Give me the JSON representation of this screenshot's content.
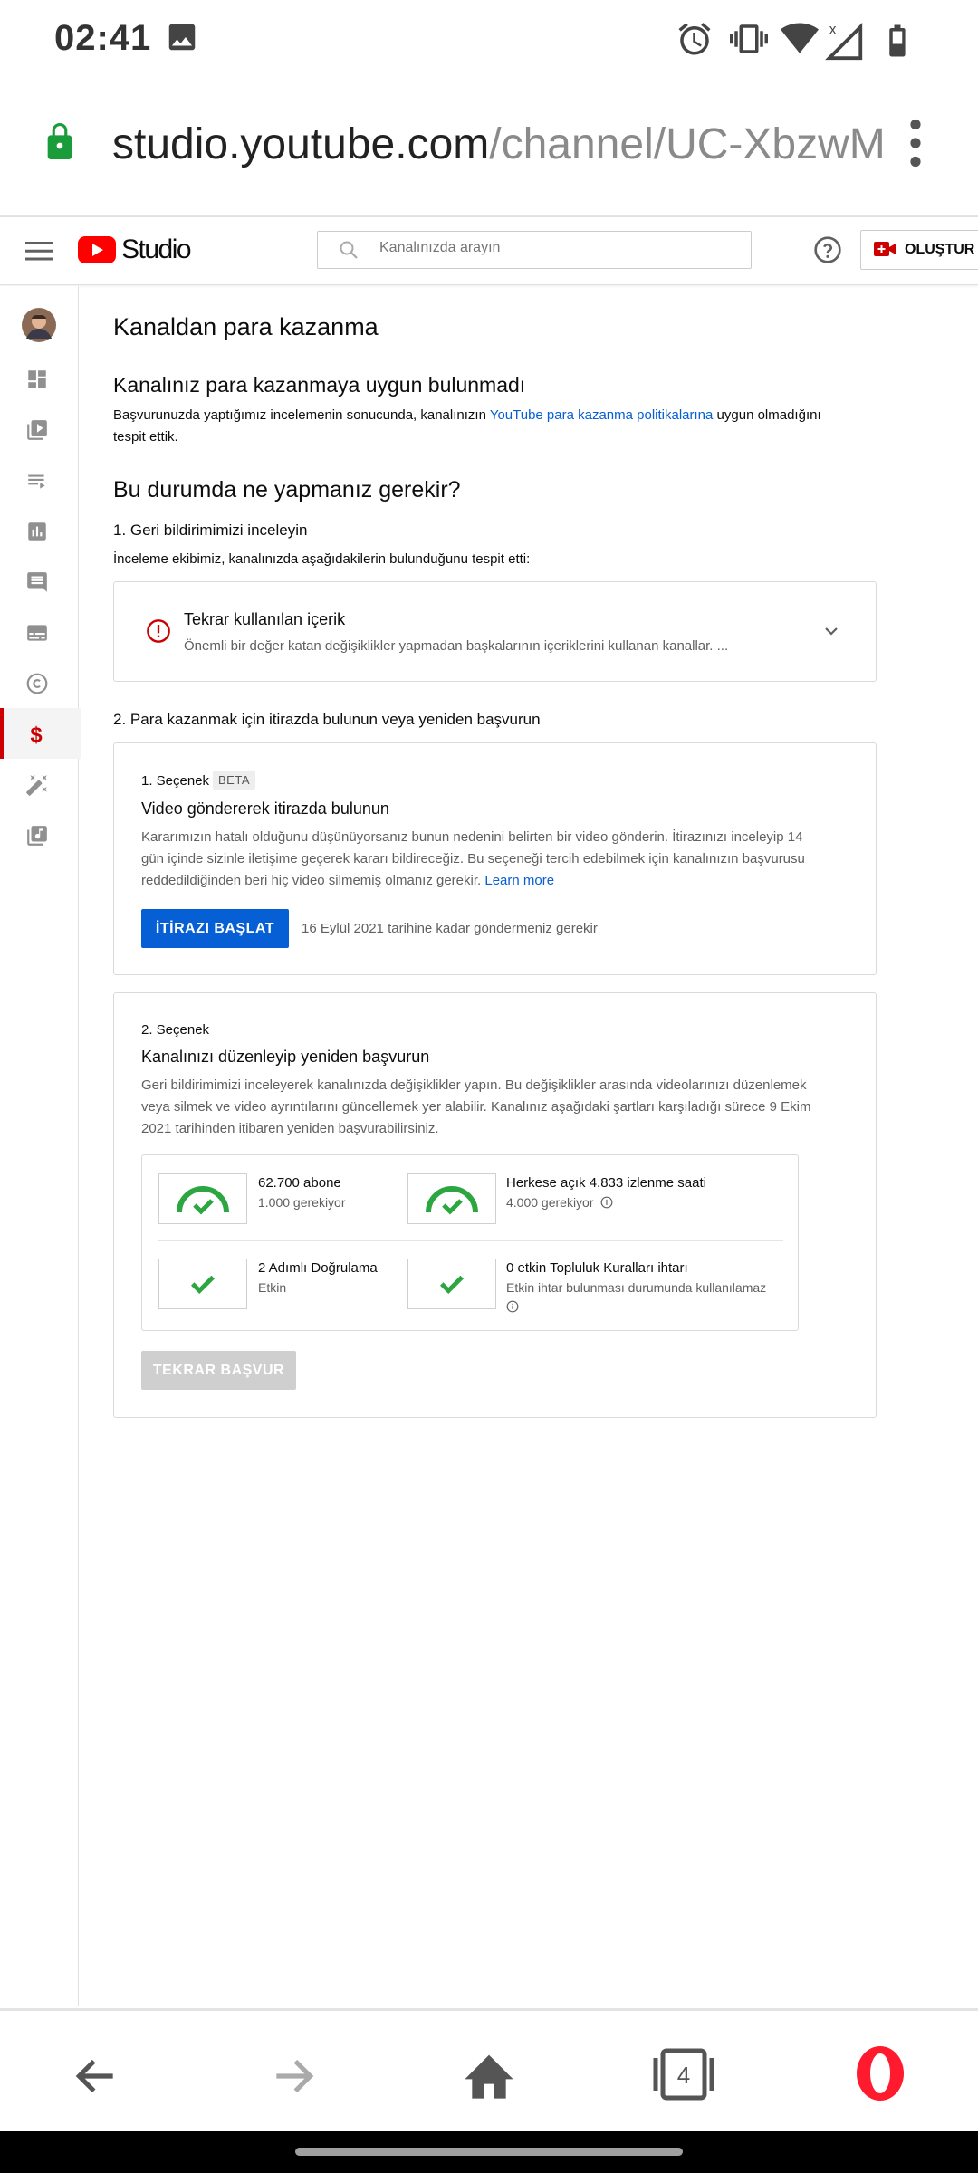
{
  "status_bar": {
    "time": "02:41",
    "icons": [
      "image-icon",
      "alarm-icon",
      "vibrate-icon",
      "wifi-icon",
      "signal-icon",
      "battery-icon"
    ]
  },
  "browser": {
    "url_host": "studio.youtube.com",
    "url_path": "/channel/UC-XbzwM",
    "tab_count": "4"
  },
  "studio_header": {
    "logo_text": "Studio",
    "search_placeholder": "Kanalınızda arayın",
    "create_label": "OLUŞTUR"
  },
  "sidebar": {
    "items": [
      "avatar",
      "dashboard-icon",
      "content-icon",
      "playlists-icon",
      "analytics-icon",
      "comments-icon",
      "subtitles-icon",
      "copyright-icon",
      "monetization-icon",
      "customization-icon",
      "audio-library-icon"
    ],
    "active": "monetization-icon"
  },
  "page": {
    "title": "Kanaldan para kazanma",
    "status_heading": "Kanalınız para kazanmaya uygun bulunmadı",
    "status_text_1": "Başvurunuzda yaptığımız incelemenin sonucunda, kanalınızın ",
    "status_link": "YouTube para kazanma politikalarına",
    "status_text_2": " uygun olmadığını",
    "status_text_3": "tespit ettik.",
    "what_heading": "Bu durumda ne yapmanız gerekir?",
    "step1_heading": "1. Geri bildirimimizi inceleyin",
    "step1_text": "İnceleme ekibimiz, kanalınızda aşağıdakilerin bulunduğunu tespit etti:",
    "issue": {
      "title": "Tekrar kullanılan içerik",
      "desc": "Önemli bir değer katan değişiklikler yapmadan başkalarının içeriklerini kullanan kanallar. ..."
    },
    "step2_heading": "2. Para kazanmak için itirazda bulunun veya yeniden başvurun",
    "option1": {
      "label": "1. Seçenek",
      "badge": "BETA",
      "title": "Video göndererek itirazda bulunun",
      "desc_1": "Kararımızın hatalı olduğunu düşünüyorsanız bunun nedenini belirten bir video gönderin. İtirazınızı inceleyip 14",
      "desc_2": "gün içinde sizinle iletişime geçerek kararı bildireceğiz. Bu seçeneği tercih edebilmek için kanalınızın başvurusu",
      "desc_3": "reddedildiğinden beri hiç video silmemiş olmanız gerekir. ",
      "learn_more": "Learn more",
      "button": "İTİRAZI BAŞLAT",
      "deadline": "16 Eylül 2021 tarihine kadar göndermeniz gerekir"
    },
    "option2": {
      "label": "2. Seçenek",
      "title": "Kanalınızı düzenleyip yeniden başvurun",
      "desc_1": "Geri bildirimimizi inceleyerek kanalınızda değişiklikler yapın. Bu değişiklikler arasında videolarınızı düzenlemek",
      "desc_2": "veya silmek ve video ayrıntılarını güncellemek yer alabilir. Kanalınız aşağıdaki şartları karşıladığı sürece 9 Ekim",
      "desc_3": "2021 tarihinden itibaren yeniden başvurabilirsiniz.",
      "requirements": [
        {
          "title": "62.700 abone",
          "sub": "1.000 gerekiyor"
        },
        {
          "title": "Herkese açık 4.833 izlenme saati",
          "sub": "4.000 gerekiyor"
        },
        {
          "title": "2 Adımlı Doğrulama",
          "sub": "Etkin"
        },
        {
          "title": "0 etkin Topluluk Kuralları ihtarı",
          "sub": "Etkin ihtar bulunması durumunda kullanılamaz"
        }
      ],
      "button": "TEKRAR BAŞVUR"
    }
  },
  "colors": {
    "accent_blue": "#065fd4",
    "youtube_red": "#ff0000",
    "success_green": "#2ba640",
    "error_red": "#cc0000",
    "opera_red": "#ff1b2d"
  }
}
